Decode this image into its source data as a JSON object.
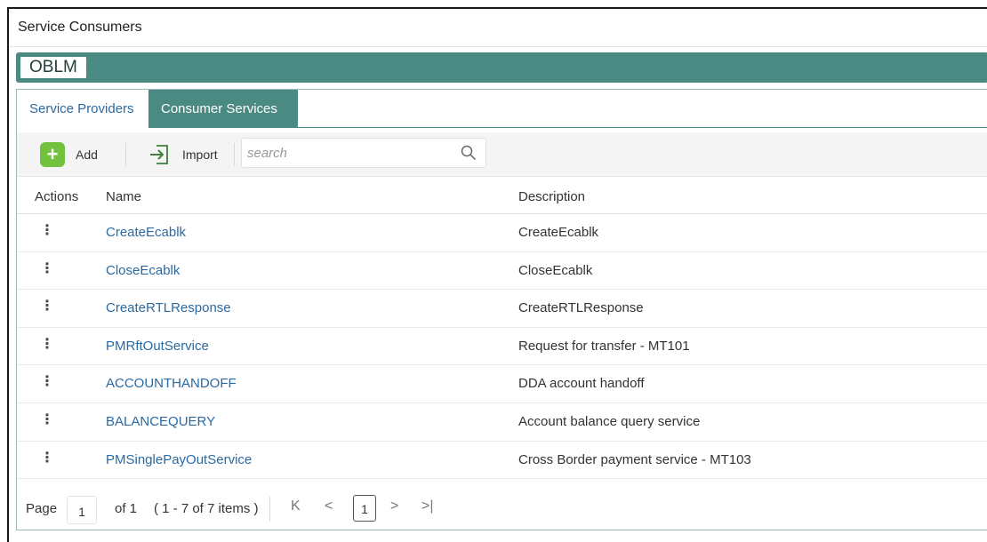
{
  "window": {
    "title": "Service Consumers"
  },
  "brand": {
    "label": "OBLM"
  },
  "tabs": [
    {
      "label": "Service Providers",
      "active": false
    },
    {
      "label": "Consumer Services",
      "active": true
    }
  ],
  "toolbar": {
    "add_label": "Add",
    "import_label": "Import",
    "search_placeholder": "search",
    "search_value": ""
  },
  "table": {
    "headers": {
      "actions": "Actions",
      "name": "Name",
      "description": "Description"
    },
    "rows": [
      {
        "name": "CreateEcablk",
        "description": "CreateEcablk"
      },
      {
        "name": "CloseEcablk",
        "description": "CloseEcablk"
      },
      {
        "name": "CreateRTLResponse",
        "description": "CreateRTLResponse"
      },
      {
        "name": "PMRftOutService",
        "description": "Request for transfer - MT101"
      },
      {
        "name": "ACCOUNTHANDOFF",
        "description": "DDA account handoff"
      },
      {
        "name": "BALANCEQUERY",
        "description": "Account balance query service"
      },
      {
        "name": "PMSinglePayOutService",
        "description": "Cross Border payment service - MT103"
      }
    ]
  },
  "pagination": {
    "page_label": "Page",
    "page_value": "1",
    "of_label": "of 1",
    "items_label": "( 1 - 7 of 7 items )",
    "current_page": "1",
    "first_glyph": "K",
    "prev_glyph": "<",
    "next_glyph": ">",
    "last_glyph": ">|"
  },
  "colors": {
    "accent": "#4b8a83",
    "link": "#2a6aa2",
    "add_icon": "#72c23e"
  }
}
